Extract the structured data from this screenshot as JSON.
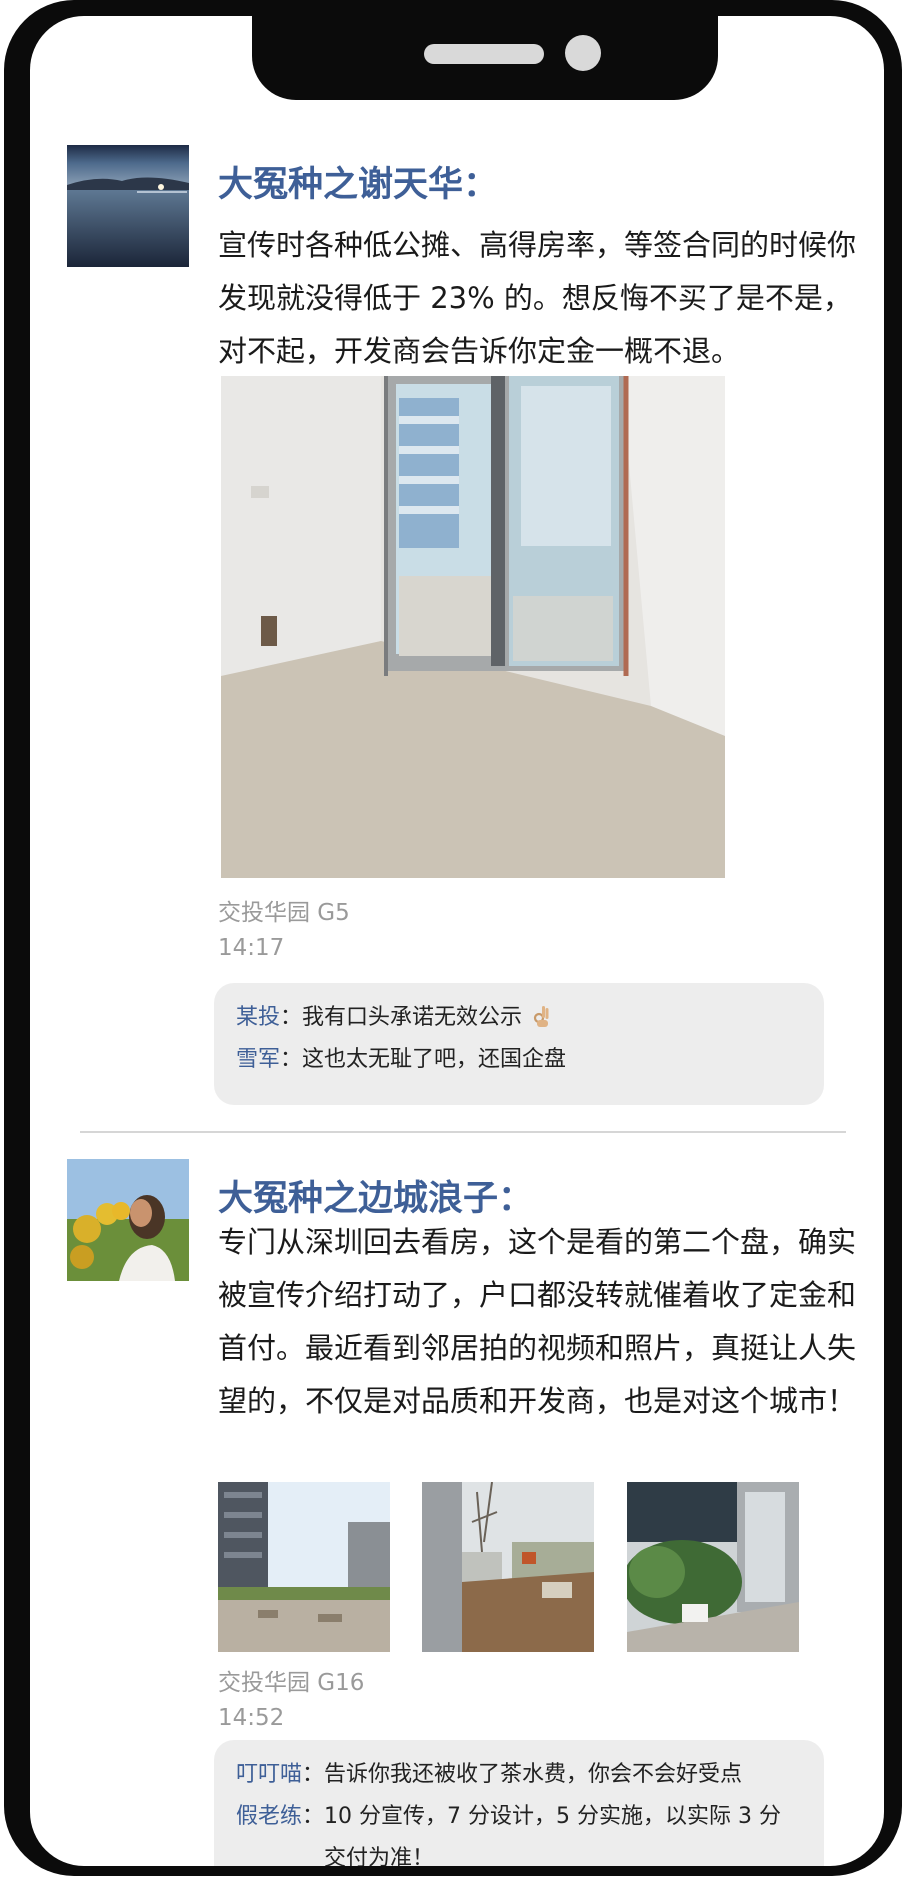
{
  "posts": [
    {
      "name": "大冤种之谢天华：",
      "text": "宣传时各种低公摊、高得房率，等签合同的时候你发现就没得低于 23% 的。想反悔不买了是不是，对不起，开发商会告诉你定金一概不退。",
      "location": "交投华园 G5",
      "time": "14:17",
      "comments": [
        {
          "user": "某投",
          "sep": "：",
          "text": "我有口头承诺无效公示"
        },
        {
          "user": "雪军",
          "sep": "：",
          "text": "这也太无耻了吧，还国企盘"
        }
      ]
    },
    {
      "name": "大冤种之边城浪子：",
      "text": "专门从深圳回去看房，这个是看的第二个盘，确实被宣传介绍打动了，户口都没转就催着收了定金和首付。最近看到邻居拍的视频和照片，真挺让人失望的，不仅是对品质和开发商，也是对这个城市！",
      "location": "交投华园 G16",
      "time": "14:52",
      "comments": [
        {
          "user": "叮叮喵",
          "sep": "：",
          "text": "告诉你我还被收了茶水费，你会不会好受点"
        },
        {
          "user": "假老练",
          "sep": "：",
          "text": "10 分宣传，7 分设计，5 分实施，以实际 3 分交付为准！"
        }
      ]
    }
  ],
  "colors": {
    "name": "#3e5f97",
    "meta": "#9a9a9a",
    "comment_bg": "#ededed"
  }
}
